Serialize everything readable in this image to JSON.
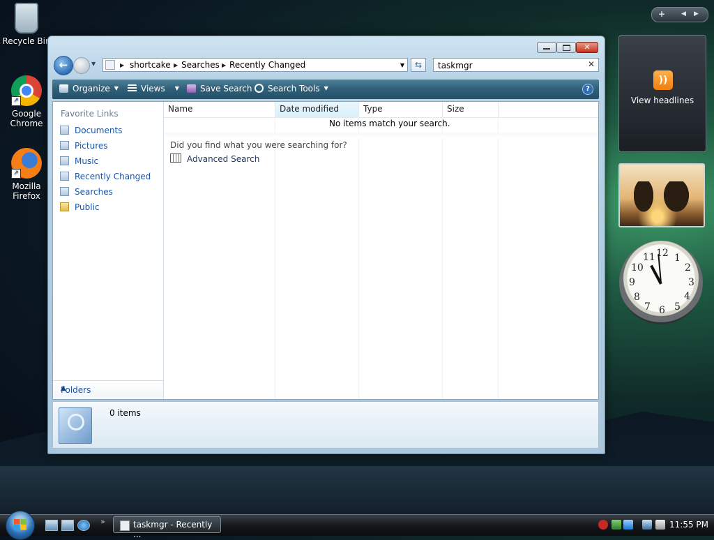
{
  "desktop": {
    "icons": [
      {
        "label": "Recycle Bin"
      },
      {
        "label": "Google Chrome"
      },
      {
        "label": "Mozilla Firefox"
      }
    ]
  },
  "window": {
    "breadcrumbs": [
      "shortcake",
      "Searches",
      "Recently Changed"
    ],
    "search_value": "taskmgr",
    "toolbar": {
      "organize": "Organize",
      "views": "Views",
      "save_search": "Save Search",
      "search_tools": "Search Tools"
    },
    "nav_pane": {
      "header": "Favorite Links",
      "links": [
        "Documents",
        "Pictures",
        "Music",
        "Recently Changed",
        "Searches",
        "Public"
      ],
      "folders_label": "Folders"
    },
    "columns": [
      "Name",
      "Date modified",
      "Type",
      "Size"
    ],
    "no_match_text": "No items match your search.",
    "did_you_find": "Did you find what you were searching for?",
    "advanced_search": "Advanced Search",
    "details": {
      "count": "0 items"
    }
  },
  "gadgets": {
    "feed_text": "View headlines",
    "clock_numbers": [
      "12",
      "1",
      "2",
      "3",
      "4",
      "5",
      "6",
      "7",
      "8",
      "9",
      "10",
      "11"
    ]
  },
  "taskbar": {
    "task_button": "taskmgr - Recently ...",
    "time": "11:55 PM"
  }
}
